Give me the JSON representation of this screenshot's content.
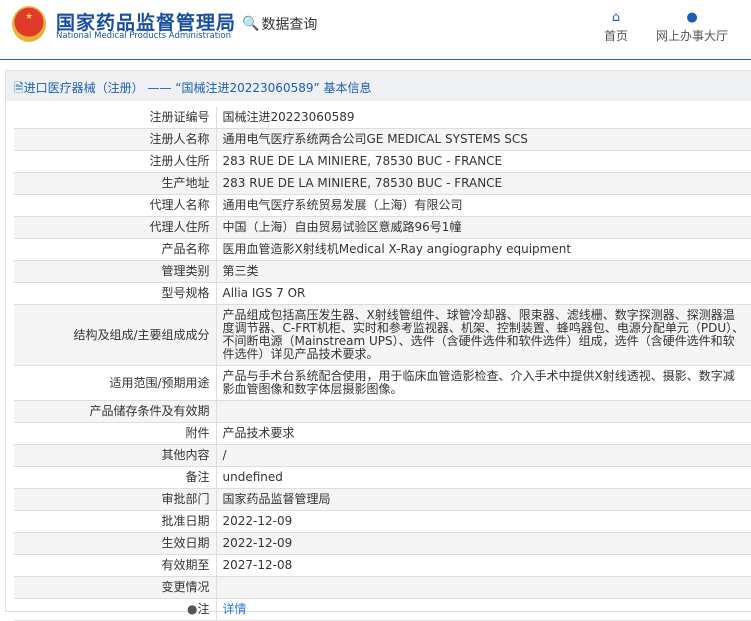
{
  "header": {
    "logo_cn": "国家药品监督管理局",
    "logo_en": "National Medical Products Administration",
    "data_query": "数据查询",
    "nav": [
      {
        "label": "首页",
        "icon": "home-icon"
      },
      {
        "label": "网上办事大厅",
        "icon": "user-icon"
      }
    ]
  },
  "title": "进口医疗器械（注册） —— “国械注进20223060589” 基本信息",
  "rows": [
    {
      "label": "注册证编号",
      "value": "国械注进20223060589"
    },
    {
      "label": "注册人名称",
      "value": "通用电气医疗系统两合公司GE MEDICAL SYSTEMS SCS"
    },
    {
      "label": "注册人住所",
      "value": "283 RUE DE LA MINIERE, 78530 BUC - FRANCE"
    },
    {
      "label": "生产地址",
      "value": "283 RUE DE LA MINIERE, 78530 BUC - FRANCE"
    },
    {
      "label": "代理人名称",
      "value": "通用电气医疗系统贸易发展（上海）有限公司"
    },
    {
      "label": "代理人住所",
      "value": "中国（上海）自由贸易试验区意威路96号1幢"
    },
    {
      "label": "产品名称",
      "value": "医用血管造影X射线机Medical X-Ray angiography equipment"
    },
    {
      "label": "管理类别",
      "value": "第三类"
    },
    {
      "label": "型号规格",
      "value": "Allia IGS 7 OR"
    },
    {
      "label": "结构及组成/主要组成成分",
      "value": "产品组成包括高压发生器、X射线管组件、球管冷却器、限束器、滤线栅、数字探测器、探测器温度调节器、C-FRT机柜、实时和参考监视器、机架、控制装置、蜂鸣器包、电源分配单元（PDU）、不间断电源（Mainstream UPS）、选件（含硬件选件和软件选件）组成，选件（含硬件选件和软件选件）详见产品技术要求。"
    },
    {
      "label": "适用范围/预期用途",
      "value": "产品与手术台系统配合使用，用于临床血管造影检查、介入手术中提供X射线透视、摄影、数字减影血管图像和数字体层摄影图像。"
    },
    {
      "label": "产品储存条件及有效期",
      "value": ""
    },
    {
      "label": "附件",
      "value": "产品技术要求"
    },
    {
      "label": "其他内容",
      "value": "/"
    },
    {
      "label": "备注",
      "value": "undefined"
    },
    {
      "label": "审批部门",
      "value": "国家药品监督管理局"
    },
    {
      "label": "批准日期",
      "value": "2022-12-09"
    },
    {
      "label": "生效日期",
      "value": "2022-12-09"
    },
    {
      "label": "有效期至",
      "value": "2027-12-08"
    },
    {
      "label": "变更情况",
      "value": ""
    }
  ],
  "note": {
    "label": "注",
    "link": "详情"
  }
}
